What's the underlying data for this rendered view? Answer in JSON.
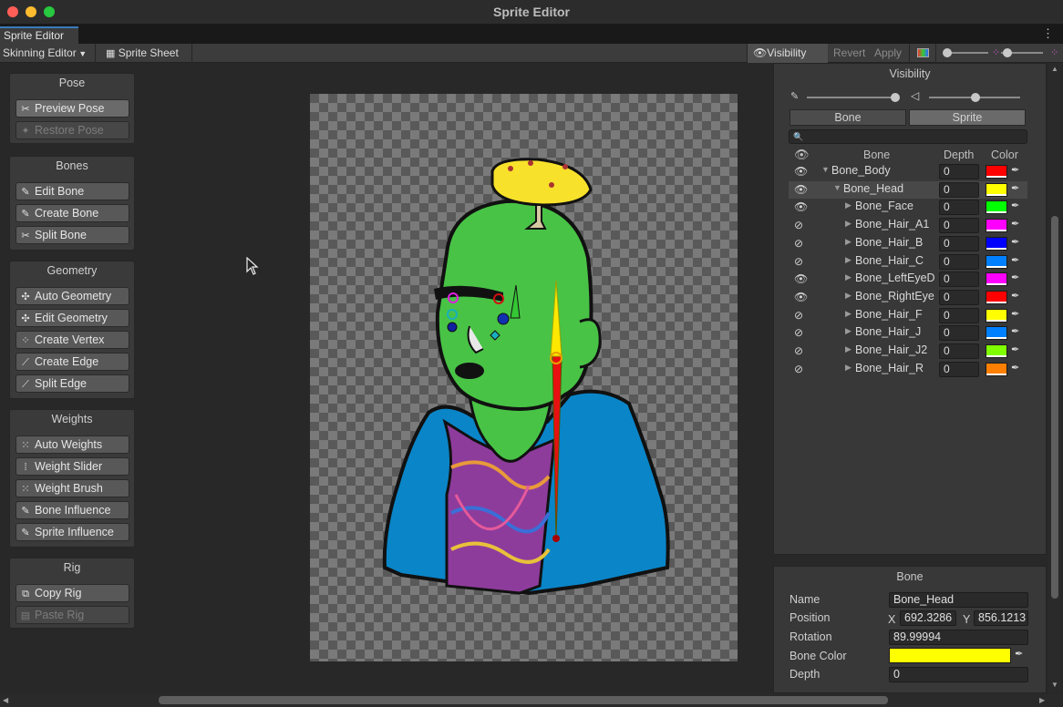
{
  "window": {
    "title": "Sprite Editor"
  },
  "tab": {
    "label": "Sprite Editor",
    "menu_icon": "kebab-menu-icon"
  },
  "toolbar": {
    "module_dropdown": "Skinning Editor",
    "sprite_sheet": "Sprite Sheet",
    "visibility": "Visibility",
    "revert": "Revert",
    "apply": "Apply"
  },
  "pose": {
    "title": "Pose",
    "preview": "Preview Pose",
    "restore": "Restore Pose"
  },
  "bones": {
    "title": "Bones",
    "edit": "Edit Bone",
    "create": "Create Bone",
    "split": "Split Bone"
  },
  "geometry": {
    "title": "Geometry",
    "auto": "Auto Geometry",
    "edit": "Edit Geometry",
    "create_vertex": "Create Vertex",
    "create_edge": "Create Edge",
    "split_edge": "Split Edge"
  },
  "weights": {
    "title": "Weights",
    "auto": "Auto Weights",
    "slider": "Weight Slider",
    "brush": "Weight Brush",
    "bone_influence": "Bone Influence",
    "sprite_influence": "Sprite Influence"
  },
  "rig": {
    "title": "Rig",
    "copy": "Copy Rig",
    "paste": "Paste Rig"
  },
  "visibility_panel": {
    "title": "Visibility",
    "tab_bone": "Bone",
    "tab_sprite": "Sprite",
    "selected_tab": "Sprite",
    "search_icon": "search-icon",
    "col_bone": "Bone",
    "col_depth": "Depth",
    "col_color": "Color",
    "rows": [
      {
        "name": "Bone_Body",
        "depth": "0",
        "color": "#ff0000",
        "visible": true,
        "expanded": true
      },
      {
        "name": "Bone_Head",
        "depth": "0",
        "color": "#ffff00",
        "visible": true,
        "expanded": true
      },
      {
        "name": "Bone_Face",
        "depth": "0",
        "color": "#00ff00",
        "visible": true,
        "expanded": false
      },
      {
        "name": "Bone_Hair_A1",
        "depth": "0",
        "color": "#ff00ff",
        "visible": false,
        "expanded": false
      },
      {
        "name": "Bone_Hair_B",
        "depth": "0",
        "color": "#0000ff",
        "visible": false,
        "expanded": false
      },
      {
        "name": "Bone_Hair_C",
        "depth": "0",
        "color": "#0080ff",
        "visible": false,
        "expanded": false
      },
      {
        "name": "Bone_LeftEyeD",
        "depth": "0",
        "color": "#ff00ff",
        "visible": true,
        "expanded": false
      },
      {
        "name": "Bone_RightEye",
        "depth": "0",
        "color": "#ff0000",
        "visible": true,
        "expanded": false
      },
      {
        "name": "Bone_Hair_F",
        "depth": "0",
        "color": "#ffff00",
        "visible": false,
        "expanded": false
      },
      {
        "name": "Bone_Hair_J",
        "depth": "0",
        "color": "#0080ff",
        "visible": false,
        "expanded": false
      },
      {
        "name": "Bone_Hair_J2",
        "depth": "0",
        "color": "#80ff00",
        "visible": false,
        "expanded": false
      },
      {
        "name": "Bone_Hair_R",
        "depth": "0",
        "color": "#ff8000",
        "visible": false,
        "expanded": false
      }
    ]
  },
  "bone_panel": {
    "title": "Bone",
    "name_label": "Name",
    "name_value": "Bone_Head",
    "position_label": "Position",
    "x_label": "X",
    "x_value": "692.3286",
    "y_label": "Y",
    "y_value": "856.1213",
    "rotation_label": "Rotation",
    "rotation_value": "89.99994",
    "color_label": "Bone Color",
    "color_value": "#ffff00",
    "depth_label": "Depth",
    "depth_value": "0"
  }
}
